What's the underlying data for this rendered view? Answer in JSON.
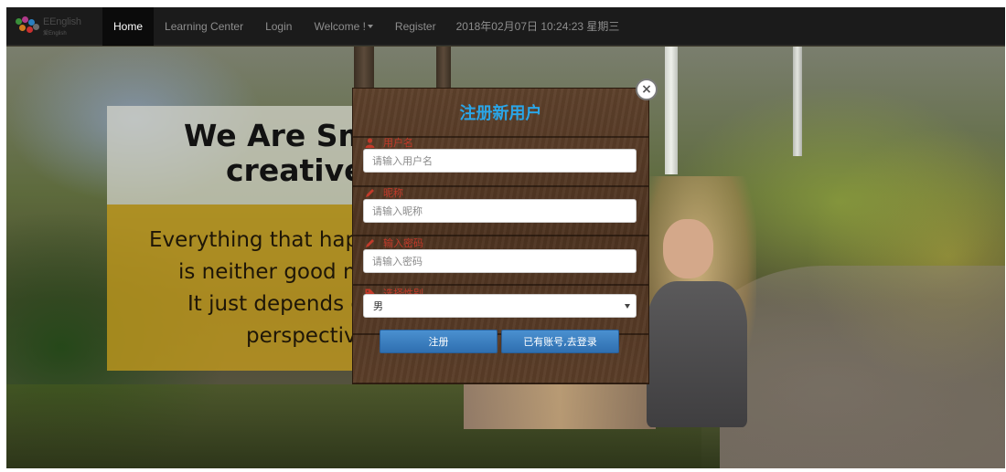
{
  "nav": {
    "brand_title": "EEnglish",
    "brand_subtitle": "爱English",
    "items": [
      {
        "label": "Home",
        "active": true
      },
      {
        "label": "Learning Center"
      },
      {
        "label": "Login"
      },
      {
        "label": "Welcome !"
      },
      {
        "label": "Register"
      }
    ],
    "datetime": "2018年02月07日 10:24:23 星期三"
  },
  "hero": {
    "title_line1": "We Are Sm",
    "title_line2": "creative.",
    "text_lines": [
      "Everything that hap",
      "is neither good n",
      "It just depends c",
      "perspectiv"
    ]
  },
  "modal": {
    "title": "注册新用户",
    "close_symbol": "×",
    "fields": {
      "username": {
        "label": "用户名",
        "placeholder": "请输入用户名",
        "icon": "user-icon"
      },
      "nickname": {
        "label": "昵称",
        "placeholder": "请输入昵称",
        "icon": "pencil-icon"
      },
      "password": {
        "label": "输入密码",
        "placeholder": "请输入密码",
        "icon": "pencil-icon"
      },
      "gender": {
        "label": "选择性别",
        "value": "男",
        "icon": "tag-icon"
      }
    },
    "buttons": {
      "register": "注册",
      "to_login": "已有账号,去登录"
    }
  },
  "colors": {
    "navbar_bg": "#1b1b1b",
    "modal_title": "#2aa6e8",
    "label_red": "#c23a2a",
    "button_blue": "#3a7fc0",
    "hero_yellow": "#c49b1e"
  }
}
